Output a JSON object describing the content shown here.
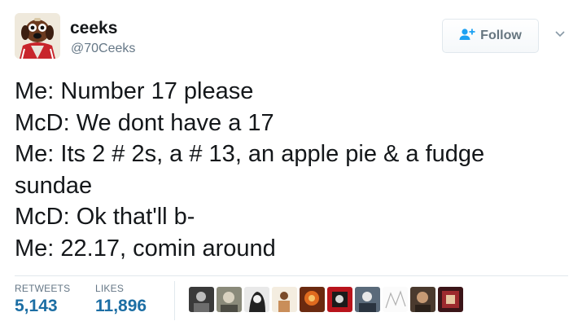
{
  "user": {
    "display_name": "ceeks",
    "handle": "@70Ceeks"
  },
  "follow_button": {
    "label": "Follow",
    "icon": "add-user-icon"
  },
  "menu": {
    "icon": "chevron-down-icon"
  },
  "tweet": {
    "lines": [
      "Me: Number 17 please",
      "McD: We dont have a 17",
      "Me: Its 2 # 2s, a # 13, an apple pie & a fudge",
      "sundae",
      "McD: Ok that'll b-",
      "Me: 22.17, comin around"
    ]
  },
  "stats": {
    "retweets_label": "RETWEETS",
    "retweets_count": "5,143",
    "likes_label": "LIKES",
    "likes_count": "11,896"
  },
  "likers_count_shown": 10,
  "colors": {
    "stat_value": "#1c6ea4",
    "muted": "#657786",
    "divider": "#e1e8ed",
    "follow_icon": "#1da1f2"
  }
}
